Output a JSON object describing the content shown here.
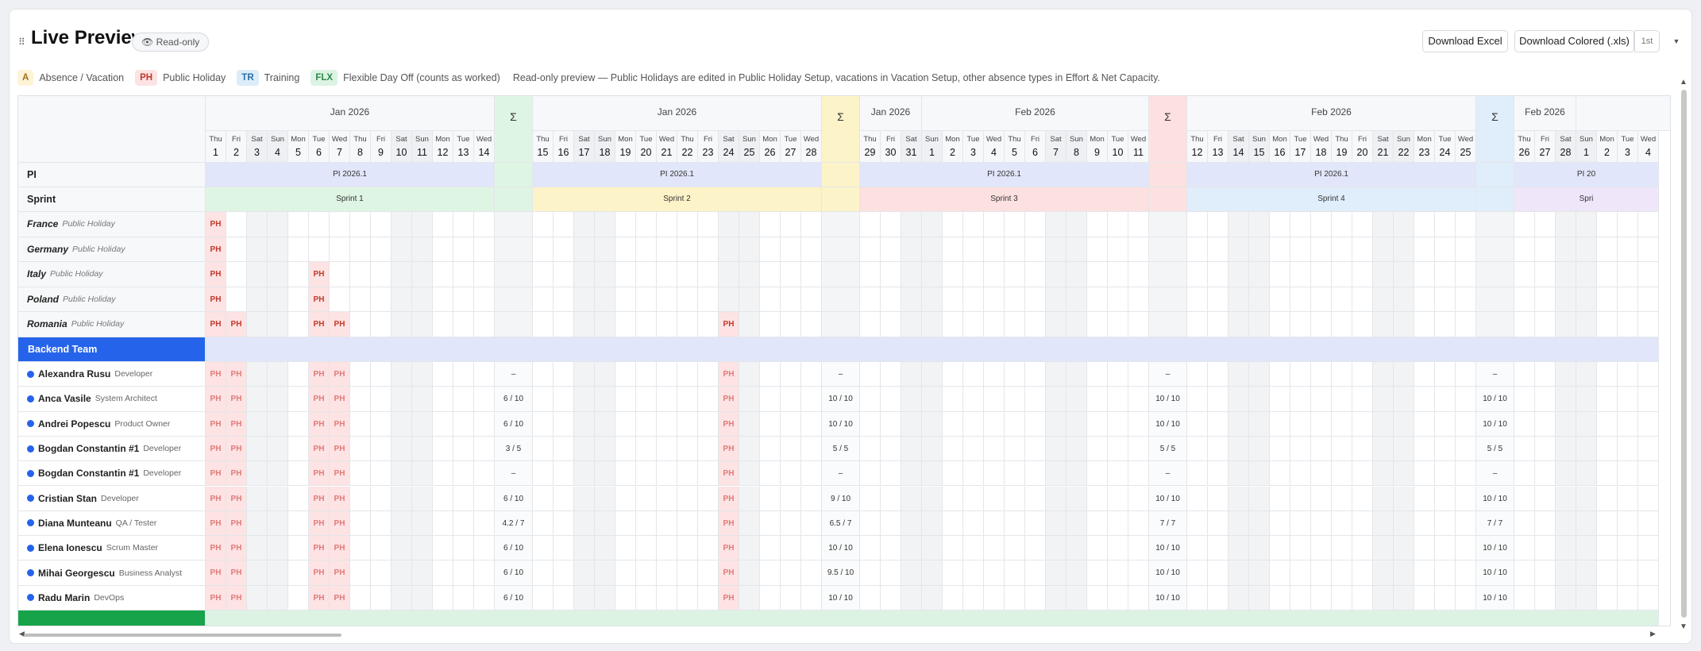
{
  "header": {
    "title": "Live Preview",
    "badge": "Read-only",
    "badge_icon": "eye-icon",
    "download_excel": "Download Excel",
    "download_colored": "Download Colored (.xls)",
    "format_select": "1st"
  },
  "legend": [
    {
      "code": "A",
      "label": "Absence / Vacation",
      "kind": "absence"
    },
    {
      "code": "PH",
      "label": "Public Holiday",
      "kind": "holiday"
    },
    {
      "code": "TR",
      "label": "Training",
      "kind": "training"
    },
    {
      "code": "FLX",
      "label": "Flexible Day Off (counts as worked)",
      "kind": "flex"
    }
  ],
  "legend_note": "Read-only preview — Public Holidays are edited in Public Holiday Setup, vacations in Vacation Setup, other absence types in Effort & Net Capacity.",
  "sigma": "Σ",
  "row_labels": {
    "pi": "PI",
    "sprint": "Sprint"
  },
  "colors": {
    "pi": "#e2e6fa",
    "sprint1": "#dff5e3",
    "sprint2": "#fdf3c8",
    "sprint3": "#fde0e0",
    "sprint4": "#e0eefb",
    "sprint5": "#efe6fa",
    "ph_cell": "#fde3e3",
    "ph_text": "#c0392b",
    "weekend": "#f2f3f5",
    "backend": "#2563eb",
    "group2": "#16a34a",
    "bullet": "#2563eb"
  },
  "segments": [
    {
      "month": "Jan 2026",
      "days": [
        [
          "Thu",
          "1"
        ],
        [
          "Fri",
          "2"
        ],
        [
          "Sat",
          "3"
        ],
        [
          "Sun",
          "4"
        ],
        [
          "Mon",
          "5"
        ],
        [
          "Tue",
          "6"
        ],
        [
          "Wed",
          "7"
        ],
        [
          "Thu",
          "8"
        ],
        [
          "Fri",
          "9"
        ],
        [
          "Sat",
          "10"
        ],
        [
          "Sun",
          "11"
        ],
        [
          "Mon",
          "12"
        ],
        [
          "Tue",
          "13"
        ],
        [
          "Wed",
          "14"
        ]
      ],
      "pi": "PI 2026.1",
      "sprint": "Sprint 1",
      "sprint_color": "sprint1"
    },
    {
      "month": "Jan 2026",
      "days": [
        [
          "Thu",
          "15"
        ],
        [
          "Fri",
          "16"
        ],
        [
          "Sat",
          "17"
        ],
        [
          "Sun",
          "18"
        ],
        [
          "Mon",
          "19"
        ],
        [
          "Tue",
          "20"
        ],
        [
          "Wed",
          "21"
        ],
        [
          "Thu",
          "22"
        ],
        [
          "Fri",
          "23"
        ],
        [
          "Sat",
          "24"
        ],
        [
          "Sun",
          "25"
        ],
        [
          "Mon",
          "26"
        ],
        [
          "Tue",
          "27"
        ],
        [
          "Wed",
          "28"
        ]
      ],
      "pi": "PI 2026.1",
      "sprint": "Sprint 2",
      "sprint_color": "sprint2"
    },
    {
      "months": [
        [
          "Jan 2026",
          3
        ],
        [
          "Feb 2026",
          11
        ]
      ],
      "days": [
        [
          "Thu",
          "29"
        ],
        [
          "Fri",
          "30"
        ],
        [
          "Sat",
          "31"
        ],
        [
          "Sun",
          "1"
        ],
        [
          "Mon",
          "2"
        ],
        [
          "Tue",
          "3"
        ],
        [
          "Wed",
          "4"
        ],
        [
          "Thu",
          "5"
        ],
        [
          "Fri",
          "6"
        ],
        [
          "Sat",
          "7"
        ],
        [
          "Sun",
          "8"
        ],
        [
          "Mon",
          "9"
        ],
        [
          "Tue",
          "10"
        ],
        [
          "Wed",
          "11"
        ]
      ],
      "pi": "PI 2026.1",
      "sprint": "Sprint 3",
      "sprint_color": "sprint3"
    },
    {
      "month": "Feb 2026",
      "days": [
        [
          "Thu",
          "12"
        ],
        [
          "Fri",
          "13"
        ],
        [
          "Sat",
          "14"
        ],
        [
          "Sun",
          "15"
        ],
        [
          "Mon",
          "16"
        ],
        [
          "Tue",
          "17"
        ],
        [
          "Wed",
          "18"
        ],
        [
          "Thu",
          "19"
        ],
        [
          "Fri",
          "20"
        ],
        [
          "Sat",
          "21"
        ],
        [
          "Sun",
          "22"
        ],
        [
          "Mon",
          "23"
        ],
        [
          "Tue",
          "24"
        ],
        [
          "Wed",
          "25"
        ]
      ],
      "pi": "PI 2026.1",
      "sprint": "Sprint 4",
      "sprint_color": "sprint4"
    },
    {
      "months": [
        [
          "Feb 2026",
          3
        ],
        [
          "",
          6
        ]
      ],
      "days": [
        [
          "Thu",
          "26"
        ],
        [
          "Fri",
          "27"
        ],
        [
          "Sat",
          "28"
        ],
        [
          "Sun",
          "1"
        ],
        [
          "Mon",
          "2"
        ],
        [
          "Tue",
          "3"
        ],
        [
          "Wed",
          "4"
        ]
      ],
      "pi": "PI 20",
      "sprint": "Spri",
      "sprint_color": "sprint5",
      "partial": true
    }
  ],
  "sigma_colors": [
    "sprint1",
    "sprint2",
    "sprint3",
    "sprint4"
  ],
  "countries": [
    {
      "name": "France",
      "type": "Public Holiday",
      "ph": [
        0
      ]
    },
    {
      "name": "Germany",
      "type": "Public Holiday",
      "ph": [
        0
      ]
    },
    {
      "name": "Italy",
      "type": "Public Holiday",
      "ph": [
        0,
        5
      ]
    },
    {
      "name": "Poland",
      "type": "Public Holiday",
      "ph": [
        0,
        5
      ]
    },
    {
      "name": "Romania",
      "type": "Public Holiday",
      "ph": [
        0,
        1,
        5,
        6,
        23
      ]
    }
  ],
  "team": {
    "name": "Backend Team"
  },
  "ph_members": [
    0,
    1,
    5,
    6,
    23
  ],
  "ph_text": "PH",
  "members": [
    {
      "name": "Alexandra Rusu",
      "role": "Developer",
      "sums": [
        "–",
        "–",
        "–",
        "–"
      ]
    },
    {
      "name": "Anca Vasile",
      "role": "System Architect",
      "sums": [
        "6 / 10",
        "10 / 10",
        "10 / 10",
        "10 / 10"
      ]
    },
    {
      "name": "Andrei Popescu",
      "role": "Product Owner",
      "sums": [
        "6 / 10",
        "10 / 10",
        "10 / 10",
        "10 / 10"
      ]
    },
    {
      "name": "Bogdan Constantin #1",
      "role": "Developer",
      "sums": [
        "3 / 5",
        "5 / 5",
        "5 / 5",
        "5 / 5"
      ]
    },
    {
      "name": "Bogdan Constantin #1",
      "role": "Developer",
      "sums": [
        "–",
        "–",
        "–",
        "–"
      ]
    },
    {
      "name": "Cristian Stan",
      "role": "Developer",
      "sums": [
        "6 / 10",
        "9 / 10",
        "10 / 10",
        "10 / 10"
      ]
    },
    {
      "name": "Diana Munteanu",
      "role": "QA / Tester",
      "sums": [
        "4.2 / 7",
        "6.5 / 7",
        "7 / 7",
        "7 / 7"
      ]
    },
    {
      "name": "Elena Ionescu",
      "role": "Scrum Master",
      "sums": [
        "6 / 10",
        "10 / 10",
        "10 / 10",
        "10 / 10"
      ]
    },
    {
      "name": "Mihai Georgescu",
      "role": "Business Analyst",
      "sums": [
        "6 / 10",
        "9.5 / 10",
        "10 / 10",
        "10 / 10"
      ]
    },
    {
      "name": "Radu Marin",
      "role": "DevOps",
      "sums": [
        "6 / 10",
        "10 / 10",
        "10 / 10",
        "10 / 10"
      ]
    }
  ],
  "next_team": {
    "name": ""
  }
}
